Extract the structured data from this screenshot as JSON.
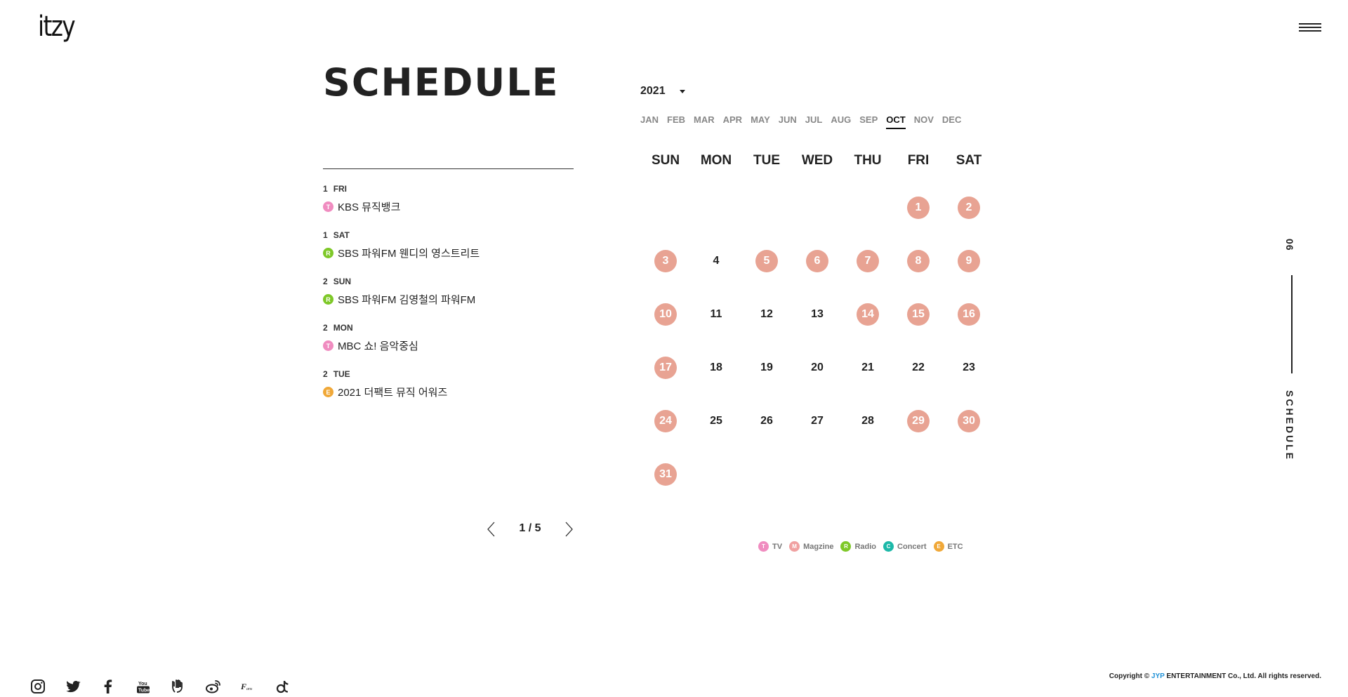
{
  "header": {
    "logo": "itzy",
    "menu_icon": "hamburger-icon"
  },
  "page": {
    "title": "SCHEDULE"
  },
  "events": [
    {
      "day": "1",
      "weekday": "FRI",
      "category": "T",
      "title": "KBS 뮤직뱅크"
    },
    {
      "day": "1",
      "weekday": "SAT",
      "category": "R",
      "title": "SBS 파워FM 웬디의 영스트리트"
    },
    {
      "day": "2",
      "weekday": "SUN",
      "category": "R",
      "title": "SBS 파워FM 김영철의 파워FM"
    },
    {
      "day": "2",
      "weekday": "MON",
      "category": "T",
      "title": "MBC 쇼! 음악중심"
    },
    {
      "day": "2",
      "weekday": "TUE",
      "category": "E",
      "title": "2021 더팩트 뮤직 어워즈"
    }
  ],
  "pager": {
    "label": "1 / 5",
    "prev_icon": "chevron-left-icon",
    "next_icon": "chevron-right-icon"
  },
  "calendar": {
    "year": "2021",
    "year_caret_icon": "caret-down-icon",
    "months": [
      "JAN",
      "FEB",
      "MAR",
      "APR",
      "MAY",
      "JUN",
      "JUL",
      "AUG",
      "SEP",
      "OCT",
      "NOV",
      "DEC"
    ],
    "active_month": "OCT",
    "weekdays": [
      "SUN",
      "MON",
      "TUE",
      "WED",
      "THU",
      "FRI",
      "SAT"
    ],
    "leading_blank_days": 5,
    "days_in_month": 31,
    "event_days": [
      1,
      2,
      3,
      5,
      6,
      7,
      8,
      9,
      10,
      14,
      15,
      16,
      17,
      24,
      29,
      30,
      31
    ],
    "event_day_color": "#e8a393"
  },
  "legend": [
    {
      "letter": "T",
      "label": "TV",
      "color": "#f08cc0"
    },
    {
      "letter": "M",
      "label": "Magzine",
      "color": "#f0a0a0"
    },
    {
      "letter": "R",
      "label": "Radio",
      "color": "#7ec828"
    },
    {
      "letter": "C",
      "label": "Concert",
      "color": "#1cb8a8"
    },
    {
      "letter": "E",
      "label": "ETC",
      "color": "#f0a838"
    }
  ],
  "side_nav": {
    "number": "06",
    "label": "SCHEDULE"
  },
  "socials": [
    "instagram-icon",
    "twitter-icon",
    "facebook-icon",
    "youtube-icon",
    "vlive-icon",
    "weibo-icon",
    "fans-icon",
    "tiktok-icon"
  ],
  "footer": {
    "copyright_prefix": "Copyright © ",
    "copyright_brand": "JYP",
    "copyright_suffix": " ENTERTAINMENT Co., Ltd. All rights reserved."
  }
}
